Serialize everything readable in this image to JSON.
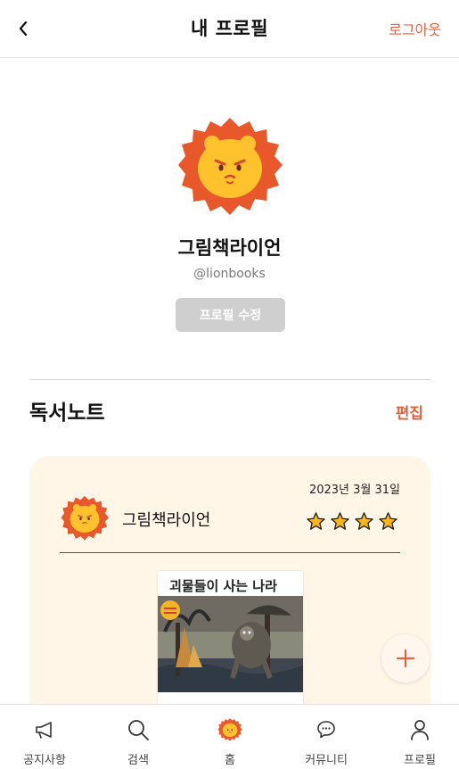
{
  "header": {
    "title": "내 프로필",
    "logout_label": "로그아웃",
    "back_icon": "chevron-left-icon"
  },
  "profile": {
    "name": "그림책라이언",
    "handle": "@lionbooks",
    "edit_label": "프로필 수정",
    "avatar_icon": "lion-avatar-icon"
  },
  "reading_notes": {
    "title": "독서노트",
    "edit_label": "편집"
  },
  "note_card": {
    "date": "2023년 3월 31일",
    "user": "그림책라이언",
    "rating": 4,
    "book_title": "괴물들이 사는 나라"
  },
  "fab": {
    "icon": "plus-icon"
  },
  "bottom_nav": {
    "items": [
      {
        "label": "공지사항",
        "icon": "megaphone-icon"
      },
      {
        "label": "검색",
        "icon": "search-icon"
      },
      {
        "label": "홈",
        "icon": "lion-home-icon"
      },
      {
        "label": "커뮤니티",
        "icon": "chat-icon"
      },
      {
        "label": "프로필",
        "icon": "user-icon"
      }
    ]
  },
  "colors": {
    "accent": "#e0633f",
    "card_bg": "#fff6e8",
    "lion_mane": "#e8582a",
    "lion_face": "#fdc22c",
    "star": "#f7b619"
  }
}
